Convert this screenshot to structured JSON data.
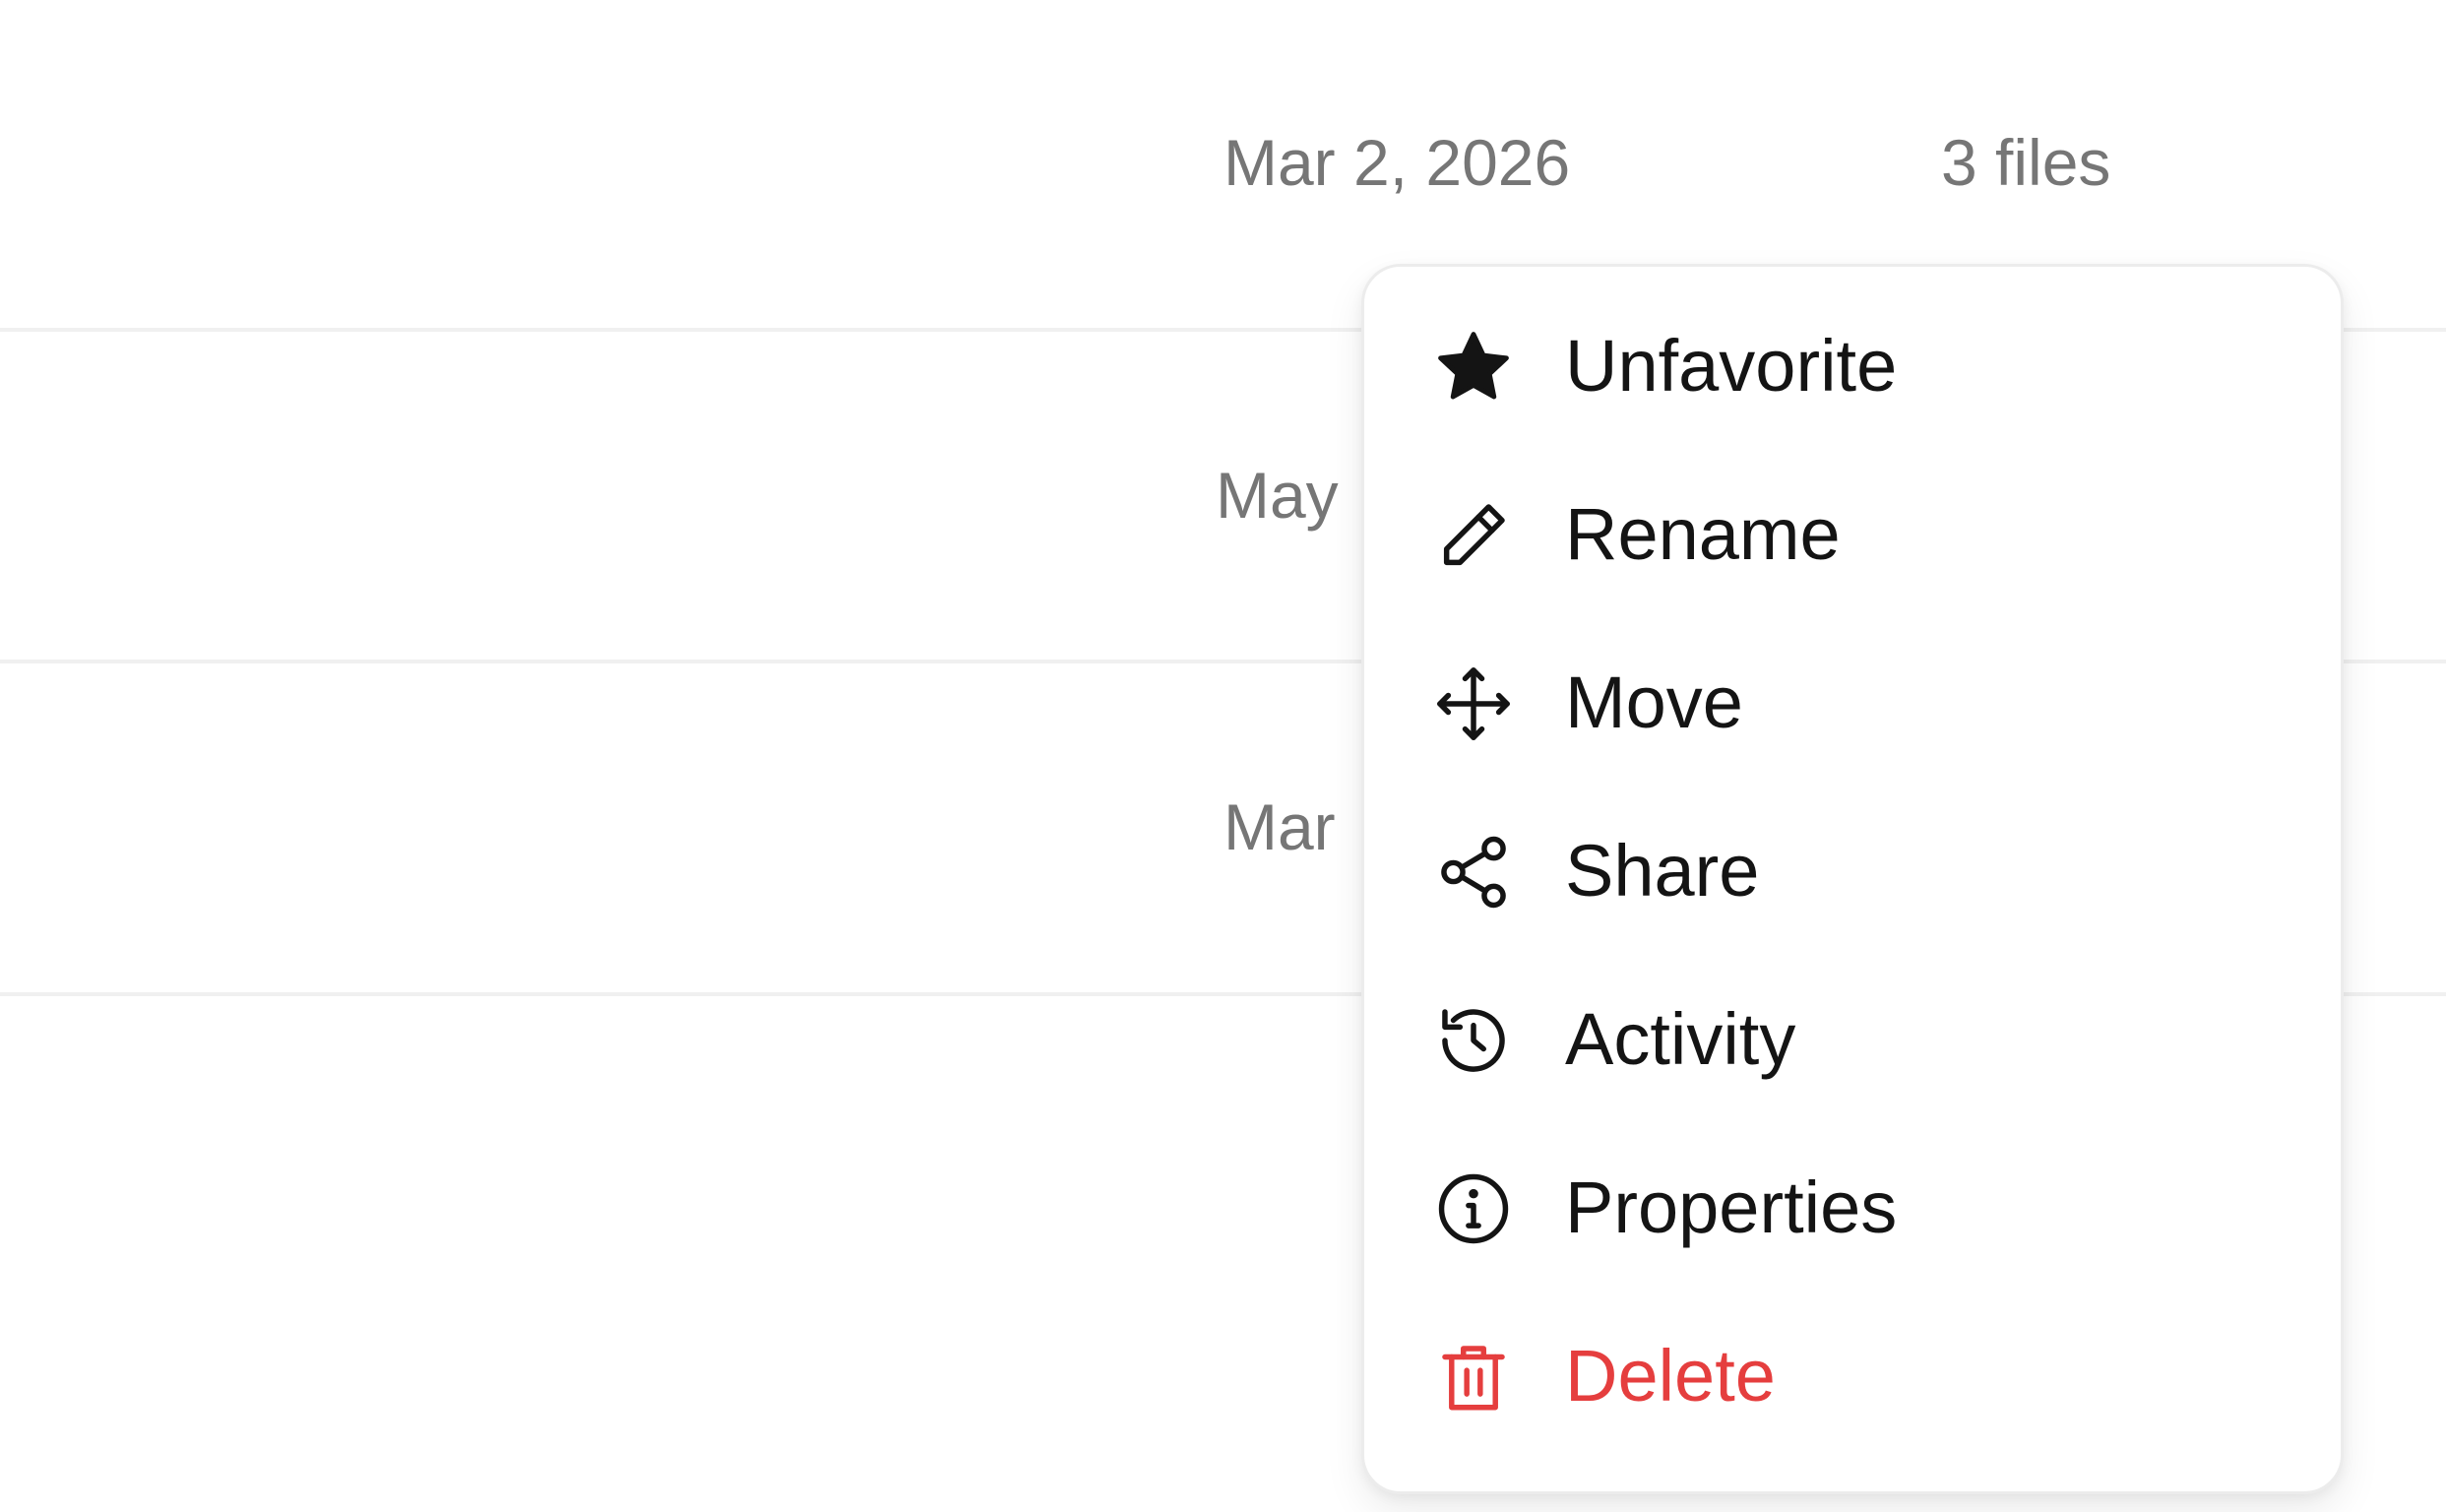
{
  "rows": [
    {
      "date": "Mar 2, 2026",
      "size": "3 files"
    },
    {
      "date": "May"
    },
    {
      "date": "Mar"
    }
  ],
  "context_menu": {
    "items": [
      {
        "label": "Unfavorite",
        "icon": "star-filled-icon"
      },
      {
        "label": "Rename",
        "icon": "pencil-icon"
      },
      {
        "label": "Move",
        "icon": "move-arrows-icon"
      },
      {
        "label": "Share",
        "icon": "share-icon"
      },
      {
        "label": "Activity",
        "icon": "history-icon"
      },
      {
        "label": "Properties",
        "icon": "info-icon"
      },
      {
        "label": "Delete",
        "icon": "trash-icon"
      }
    ]
  },
  "colors": {
    "text_primary": "#141414",
    "text_secondary": "#767676",
    "danger": "#e53e3e",
    "divider": "#f0f0f0"
  }
}
